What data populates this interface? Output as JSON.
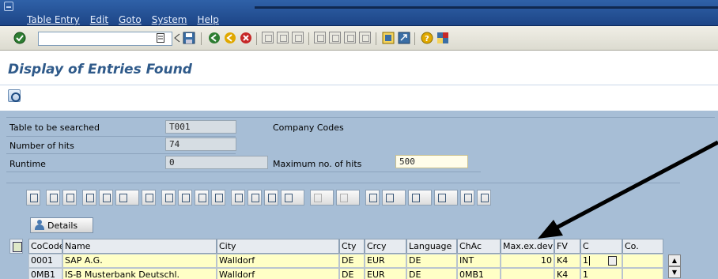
{
  "menu": {
    "items": [
      "Table Entry",
      "Edit",
      "Goto",
      "System",
      "Help"
    ]
  },
  "toolbar": {
    "command_value": "",
    "icons": [
      "enter-icon",
      "save-icon",
      "back-icon",
      "exit-icon",
      "cancel-icon",
      "print-icon",
      "find-icon",
      "find-next-icon",
      "first-page-icon",
      "previous-page-icon",
      "next-page-icon",
      "last-page-icon",
      "create-session-icon",
      "shortcut-icon",
      "help-icon",
      "customize-layout-icon"
    ]
  },
  "title": "Display of Entries Found",
  "info": {
    "table_label": "Table to be searched",
    "table_value": "T001",
    "table_desc": "Company Codes",
    "hits_label": "Number of hits",
    "hits_value": "74",
    "runtime_label": "Runtime",
    "runtime_value": "0",
    "max_hits_label": "Maximum no. of hits",
    "max_hits_value": "500"
  },
  "details_label": "Details",
  "grid": {
    "columns": [
      "CoCode",
      "Name",
      "City",
      "Cty",
      "Crcy",
      "Language",
      "ChAc",
      "Max.ex.dev",
      "FV",
      "C",
      "Co."
    ],
    "rows": [
      [
        "0001",
        "SAP A.G.",
        "Walldorf",
        "DE",
        "EUR",
        "DE",
        "INT",
        "10",
        "K4",
        "1",
        ""
      ],
      [
        "0MB1",
        "IS-B Musterbank Deutschl.",
        "Walldorf",
        "DE",
        "EUR",
        "DE",
        "0MB1",
        "",
        "K4",
        "1",
        ""
      ]
    ]
  },
  "colors": {
    "menubar": "#1d4586",
    "title": "#2f5a8a",
    "info_bg": "#a7bed6",
    "input_bg": "#fffdea",
    "grid_yellow": "#ffffc6"
  }
}
